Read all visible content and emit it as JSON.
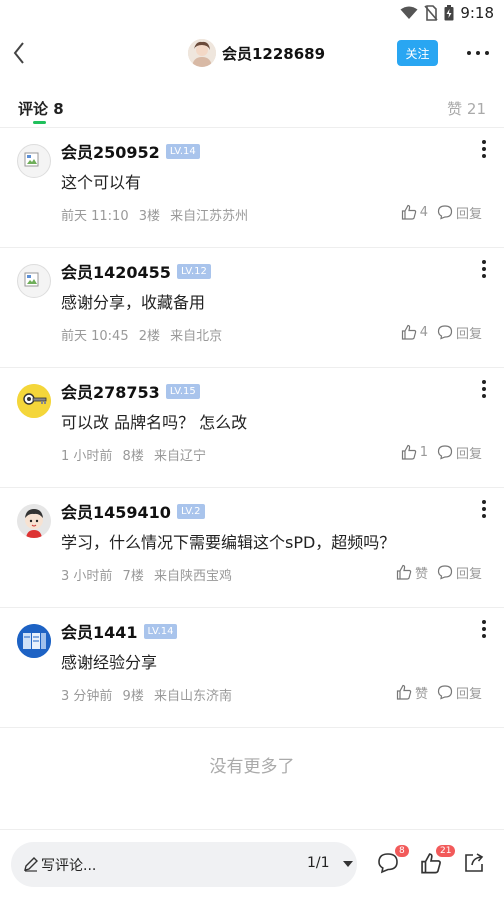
{
  "status_bar": {
    "time": "9:18"
  },
  "header": {
    "author_name": "会员1228689",
    "follow_label": "关注"
  },
  "tabs": {
    "comments_label": "评论 8",
    "likes_label": "赞 21"
  },
  "comments": [
    {
      "name": "会员250952",
      "level": "LV.14",
      "text": "这个可以有",
      "time": "前天 11:10",
      "floor": "3楼",
      "location": "来自江苏苏州",
      "likes": "4",
      "reply_label": "回复",
      "avatar": "broken-image"
    },
    {
      "name": "会员1420455",
      "level": "LV.12",
      "text": "感谢分享，收藏备用",
      "time": "前天 10:45",
      "floor": "2楼",
      "location": "来自北京",
      "likes": "4",
      "reply_label": "回复",
      "avatar": "broken-image"
    },
    {
      "name": "会员278753",
      "level": "LV.15",
      "text": "可以改 品牌名吗？ 怎么改",
      "time": "1 小时前",
      "floor": "8楼",
      "location": "来自辽宁",
      "likes": "1",
      "reply_label": "回复",
      "avatar": "yellow-key-avatar"
    },
    {
      "name": "会员1459410",
      "level": "LV.2",
      "text": "学习，什么情况下需要编辑这个sPD，超频吗？",
      "time": "3 小时前",
      "floor": "7楼",
      "location": "来自陕西宝鸡",
      "likes": "赞",
      "reply_label": "回复",
      "avatar": "cartoon-boy-avatar"
    },
    {
      "name": "会员1441",
      "level": "LV.14",
      "text": "感谢经验分享",
      "time": "3 分钟前",
      "floor": "9楼",
      "location": "来自山东济南",
      "likes": "赞",
      "reply_label": "回复",
      "avatar": "blue-document-avatar"
    }
  ],
  "footer_text": "没有更多了",
  "bottom_bar": {
    "write_placeholder": "写评论...",
    "page_indicator": "1/1",
    "comments_badge": "8",
    "likes_badge": "21"
  },
  "colors": {
    "accent_blue": "#29a6f2",
    "tab_green": "#20c05c",
    "level_badge": "#a9c4ec",
    "badge_red": "#f25a5a"
  }
}
